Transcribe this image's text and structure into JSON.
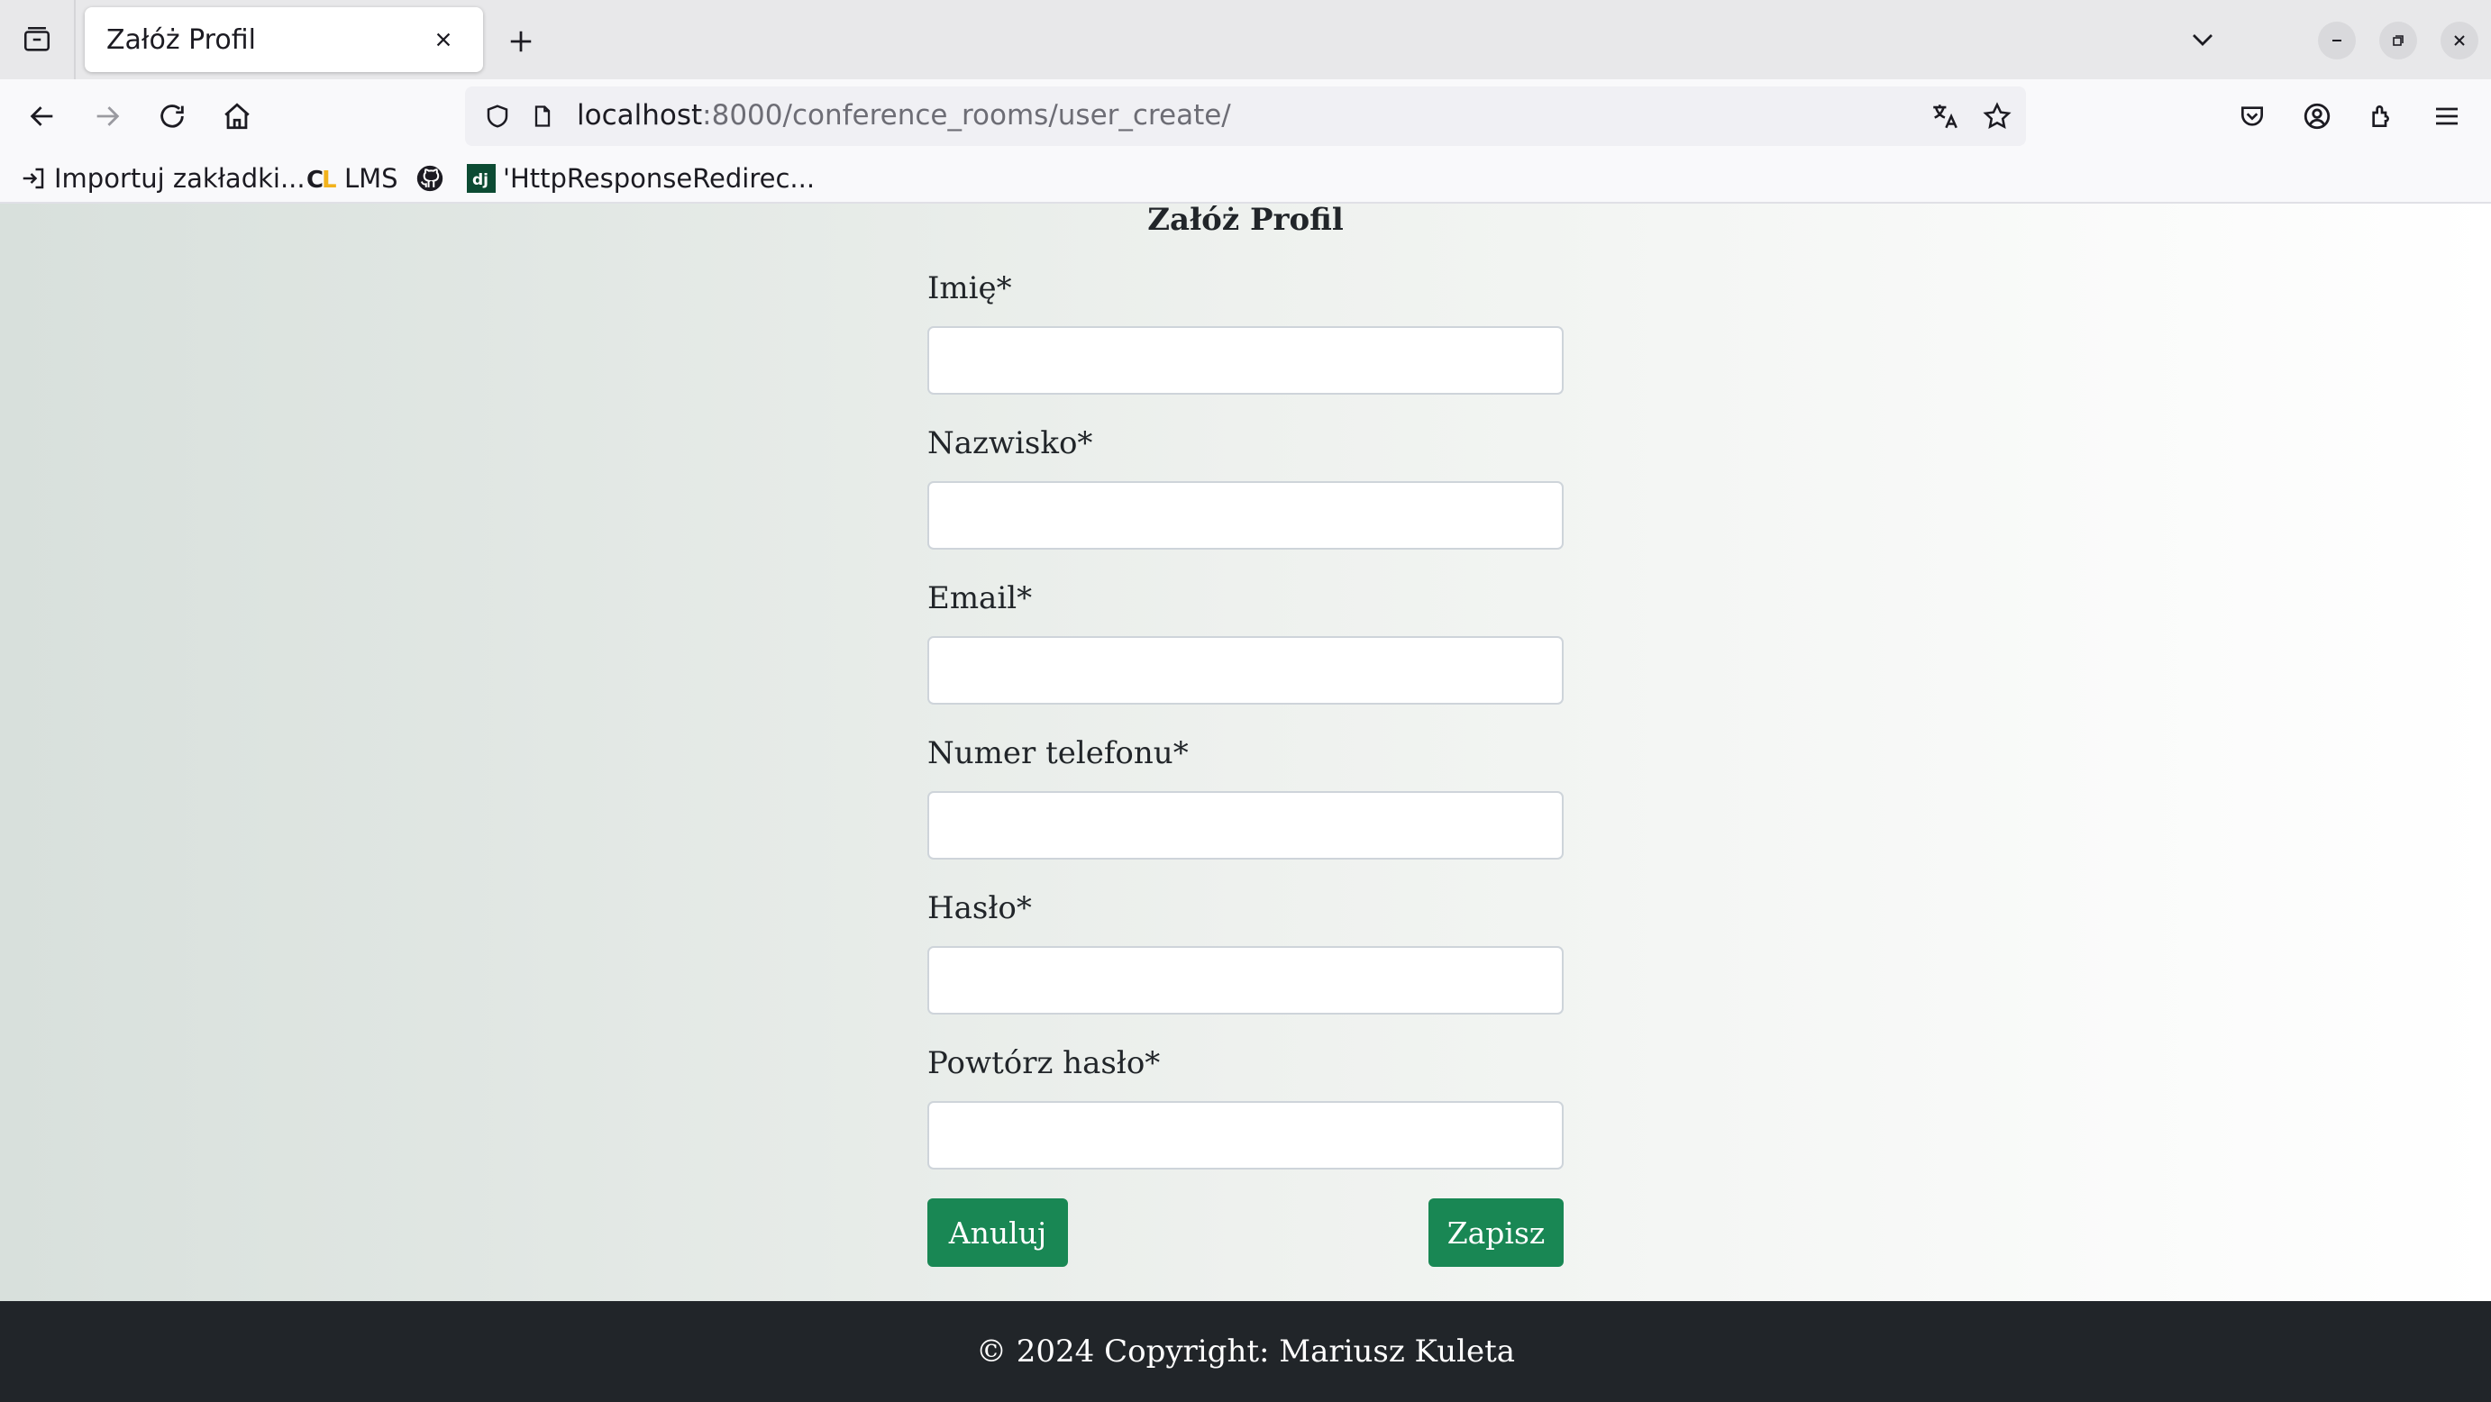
{
  "browser": {
    "tab_title": "Załóż Profil",
    "url_host": "localhost",
    "url_rest": ":8000/conference_rooms/user_create/",
    "bookmarks": [
      {
        "label": "Importuj zakładki..."
      },
      {
        "label": "LMS"
      },
      {
        "label": ""
      },
      {
        "label": "'HttpResponseRedirec..."
      }
    ]
  },
  "form": {
    "title": "Załóż Profil",
    "fields": [
      {
        "label": "Imię*",
        "value": ""
      },
      {
        "label": "Nazwisko*",
        "value": ""
      },
      {
        "label": "Email*",
        "value": ""
      },
      {
        "label": "Numer telefonu*",
        "value": ""
      },
      {
        "label": "Hasło*",
        "value": ""
      },
      {
        "label": "Powtórz hasło*",
        "value": ""
      }
    ],
    "cancel_label": "Anuluj",
    "submit_label": "Zapisz"
  },
  "footer": {
    "text": "© 2024 Copyright: Mariusz Kuleta"
  },
  "colors": {
    "button": "#198754",
    "footer_bg": "#212529"
  }
}
